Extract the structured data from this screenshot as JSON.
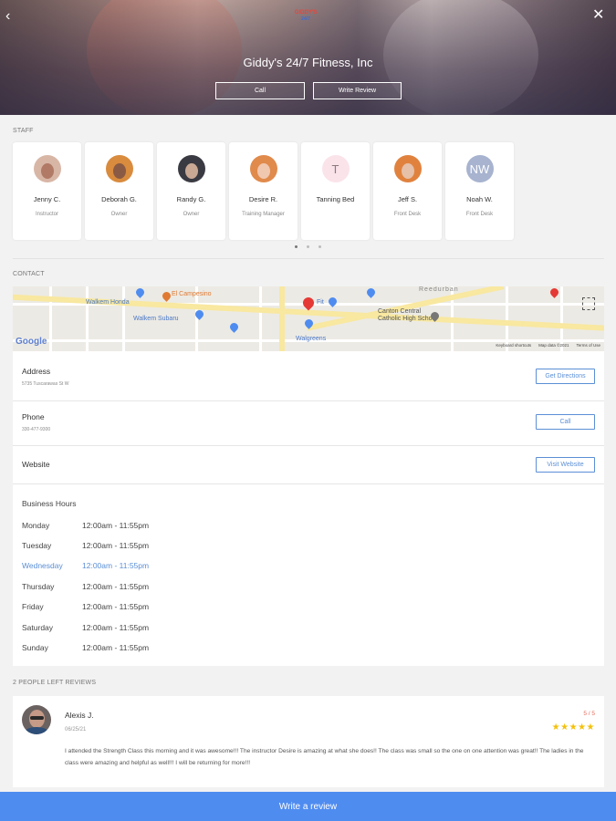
{
  "header": {
    "logo_top": "GIDDY'S",
    "logo_bottom": "24/7",
    "title": "Giddy's 24/7 Fitness, Inc",
    "call_label": "Call",
    "review_label": "Write Review",
    "back_glyph": "‹",
    "close_glyph": "✕"
  },
  "staff": {
    "section_label": "STAFF",
    "members": [
      {
        "name": "Jenny C.",
        "role": "Instructor"
      },
      {
        "name": "Deborah G.",
        "role": "Owner"
      },
      {
        "name": "Randy G.",
        "role": "Owner"
      },
      {
        "name": "Desire R.",
        "role": "Training Manager"
      },
      {
        "name": "Tanning Bed",
        "role": "",
        "initials": "T"
      },
      {
        "name": "Jeff S.",
        "role": "Front Desk"
      },
      {
        "name": "Noah W.",
        "role": "Front Desk",
        "initials": "NW"
      }
    ]
  },
  "contact": {
    "section_label": "CONTACT",
    "map": {
      "labels": {
        "walkem_honda": "Walkem Honda",
        "el_campesino": "El Campesino",
        "walkem_subaru": "Walkem Subaru",
        "walgreens": "Walgreens",
        "school": "Canton Central Catholic High School",
        "reedurban": "Reedurban",
        "fitness": "Fit"
      },
      "google": "Google",
      "keyboard_shortcuts": "Keyboard shortcuts",
      "map_data": "Map data ©2021",
      "terms": "Terms of Use"
    },
    "address_label": "Address",
    "address_value": "5735 Tuscarawas St W",
    "directions_button": "Get Directions",
    "phone_label": "Phone",
    "phone_value": "330-477-9300",
    "call_button": "Call",
    "website_label": "Website",
    "website_button": "Visit Website",
    "hours_title": "Business Hours",
    "hours": [
      {
        "day": "Monday",
        "time": "12:00am - 11:55pm"
      },
      {
        "day": "Tuesday",
        "time": "12:00am - 11:55pm"
      },
      {
        "day": "Wednesday",
        "time": "12:00am - 11:55pm"
      },
      {
        "day": "Thursday",
        "time": "12:00am - 11:55pm"
      },
      {
        "day": "Friday",
        "time": "12:00am - 11:55pm"
      },
      {
        "day": "Saturday",
        "time": "12:00am - 11:55pm"
      },
      {
        "day": "Sunday",
        "time": "12:00am - 11:55pm"
      }
    ]
  },
  "reviews": {
    "section_label": "2 PEOPLE LEFT REVIEWS",
    "items": [
      {
        "name": "Alexis J.",
        "date": "06/25/21",
        "score": "5 / 5",
        "stars": "★★★★★",
        "text": "I attended the Strength Class this morning and it was awesome!!! The instructor Desire is amazing at what she does!! The class was small so the one on one attention was great!! The ladies in the class were amazing and helpful as well!!! I will be returning for more!!!"
      }
    ]
  },
  "bottom_bar": {
    "label": "Write a review"
  },
  "colors": {
    "accent": "#4f8cf0",
    "link": "#5b8fd6",
    "star": "#f3c10c",
    "score": "#e06b5c"
  }
}
